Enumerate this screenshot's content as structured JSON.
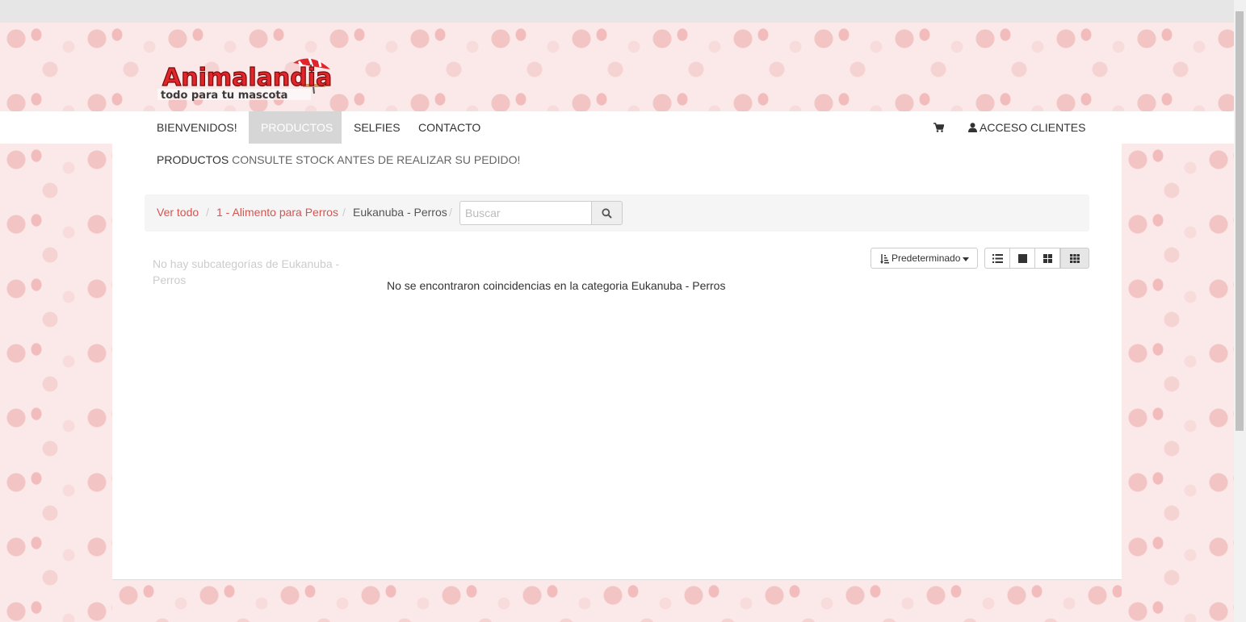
{
  "brand": {
    "name": "Animalandia",
    "tagline": "todo para tu mascota",
    "colors": {
      "accent": "#d9534f",
      "logo_red": "#e0262b"
    }
  },
  "nav": {
    "items": [
      {
        "label": "BIENVENIDOS!"
      },
      {
        "label": "PRODUCTOS",
        "active": true
      },
      {
        "label": "SELFIES"
      },
      {
        "label": "CONTACTO"
      }
    ],
    "cart_icon": "shopping-cart-icon",
    "account_icon": "user-icon",
    "account_label": "ACCESO CLIENTES"
  },
  "page": {
    "title": "PRODUCTOS",
    "subtitle": "CONSULTE STOCK ANTES DE REALIZAR SU PEDIDO!"
  },
  "breadcrumb": {
    "items": [
      "Ver todo",
      "1 - Alimento para Perros",
      "Eukanuba - Perros"
    ],
    "separator": "/",
    "search_placeholder": "Buscar",
    "search_icon": "search-icon"
  },
  "sidebar": {
    "empty_text": "No hay subcategorías de Eukanuba - Perros"
  },
  "results": {
    "empty_text": "No se encontraron coincidencias en la categoria Eukanuba - Perros",
    "sort_label": "Predeterminado",
    "view_modes": [
      "list-view-icon",
      "large-grid-icon",
      "medium-grid-icon",
      "small-grid-icon"
    ],
    "active_view": "small-grid-icon"
  }
}
